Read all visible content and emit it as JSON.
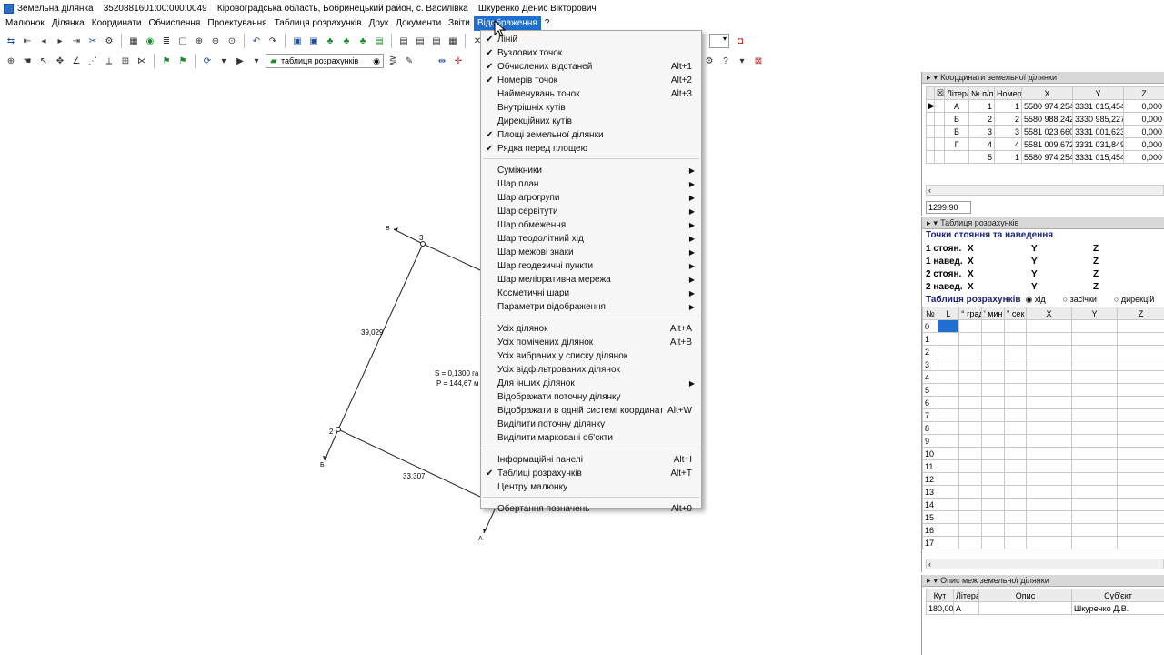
{
  "titlebar": {
    "app": "Земельна ділянка",
    "cadastral": "3520881601:00:000:0049",
    "location": "Кіровоградська область, Бобринецький район, с. Василівка",
    "user": "Шкуренко Денис Вікторович"
  },
  "menubar": [
    "Малюнок",
    "Ділянка",
    "Координати",
    "Обчислення",
    "Проектування",
    "Таблиця розрахунків",
    "Друк",
    "Документи",
    "Звіти",
    "Відображення",
    "?"
  ],
  "toolbar2": {
    "combo": "таблиця розрахунків"
  },
  "display_menu": {
    "group1": [
      {
        "label": "Ліній",
        "checked": true,
        "shortcut": ""
      },
      {
        "label": "Вузлових точок",
        "checked": true,
        "shortcut": ""
      },
      {
        "label": "Обчислених відстаней",
        "checked": true,
        "shortcut": "Alt+1"
      },
      {
        "label": "Номерів точок",
        "checked": true,
        "shortcut": "Alt+2"
      },
      {
        "label": "Найменувань точок",
        "checked": false,
        "shortcut": "Alt+3"
      },
      {
        "label": "Внутрішніх кутів",
        "checked": false,
        "shortcut": ""
      },
      {
        "label": "Дирекційних кутів",
        "checked": false,
        "shortcut": ""
      },
      {
        "label": "Площі земельної ділянки",
        "checked": true,
        "shortcut": ""
      },
      {
        "label": "Рядка перед площею",
        "checked": true,
        "shortcut": ""
      }
    ],
    "group2": [
      "Суміжники",
      "Шар план",
      "Шар агрогрупи",
      "Шар сервітути",
      "Шар обмеження",
      "Шар теодолітний хід",
      "Шар межові знаки",
      "Шар геодезичні пункти",
      "Шар меліоративна мережа",
      "Косметичні шари",
      "Параметри відображення"
    ],
    "group3": [
      {
        "label": "Усіх ділянок",
        "shortcut": "Alt+A",
        "submenu": false
      },
      {
        "label": "Усіх помічених ділянок",
        "shortcut": "Alt+B",
        "submenu": false
      },
      {
        "label": "Усіх вибраних у списку ділянок",
        "shortcut": "",
        "submenu": false
      },
      {
        "label": "Усіх відфільтрованих ділянок",
        "shortcut": "",
        "submenu": false
      },
      {
        "label": "Для інших ділянок",
        "shortcut": "",
        "submenu": true
      },
      {
        "label": "Відображати поточну ділянку",
        "shortcut": "",
        "submenu": false
      },
      {
        "label": "Відображати в одній системі координат",
        "shortcut": "Alt+W",
        "submenu": false
      },
      {
        "label": "Виділити поточну ділянку",
        "shortcut": "",
        "submenu": false
      },
      {
        "label": "Виділити марковані об'єкти",
        "shortcut": "",
        "submenu": false
      }
    ],
    "group4": [
      {
        "label": "Інформаційні панелі",
        "checked": false,
        "shortcut": "Alt+I"
      },
      {
        "label": "Таблиці розрахунків",
        "checked": true,
        "shortcut": "Alt+T"
      },
      {
        "label": "Центру малюнку",
        "checked": false,
        "shortcut": ""
      }
    ],
    "group5": [
      {
        "label": "Обертання позначень",
        "checked": false,
        "shortcut": "Alt+0"
      }
    ]
  },
  "drawing": {
    "labels": {
      "p3": "3",
      "p2": "2",
      "pB": "В",
      "pBe": "Б",
      "pA": "А",
      "d1": "39,029",
      "d2": "33,307",
      "area": "S = 0,1300 га",
      "perim": "P = 144,67 м"
    }
  },
  "coords_panel": {
    "title": "Координати земельної ділянки",
    "headers": [
      "Літера",
      "№ п/п",
      "Номер",
      "X",
      "Y",
      "Z"
    ],
    "rows": [
      [
        "А",
        "1",
        "1",
        "5580 974,254",
        "3331 015,454",
        "0,000"
      ],
      [
        "Б",
        "2",
        "2",
        "5580 988,242",
        "3330 985,227",
        "0,000"
      ],
      [
        "В",
        "3",
        "3",
        "5581 023,660",
        "3331 001,623",
        "0,000"
      ],
      [
        "Г",
        "4",
        "4",
        "5581 009,672",
        "3331 031,849",
        "0,000"
      ],
      [
        "",
        "5",
        "1",
        "5580 974,254",
        "3331 015,454",
        "0,000"
      ]
    ],
    "footer_value": "1299,90"
  },
  "calc_panel": {
    "title": "Таблиця розрахунків",
    "subtitle": "Точки стояння та наведення",
    "rows": [
      {
        "label": "1 стоян.",
        "x": "X",
        "y": "Y",
        "z": "Z"
      },
      {
        "label": "1 навед.",
        "x": "X",
        "y": "Y",
        "z": "Z"
      },
      {
        "label": "2 стоян.",
        "x": "X",
        "y": "Y",
        "z": "Z"
      },
      {
        "label": "2 навед.",
        "x": "X",
        "y": "Y",
        "z": "Z"
      }
    ],
    "table_label": "Таблиця розрахунків",
    "radios": [
      "хід",
      "засічки",
      "дирекцій"
    ],
    "headers": [
      "№",
      "L",
      "° град",
      "' мин",
      "'' сек",
      "X",
      "Y",
      "Z"
    ],
    "row_numbers": [
      "0",
      "1",
      "2",
      "3",
      "4",
      "5",
      "6",
      "7",
      "8",
      "9",
      "10",
      "11",
      "12",
      "13",
      "14",
      "15",
      "16",
      "17"
    ]
  },
  "bounds_panel": {
    "title": "Опис меж земельної ділянки",
    "headers": [
      "Кут",
      "Літера",
      "Опис",
      "Суб'єкт"
    ],
    "row": [
      "180,00",
      "А",
      "",
      "Шкуренко Д.В."
    ]
  }
}
